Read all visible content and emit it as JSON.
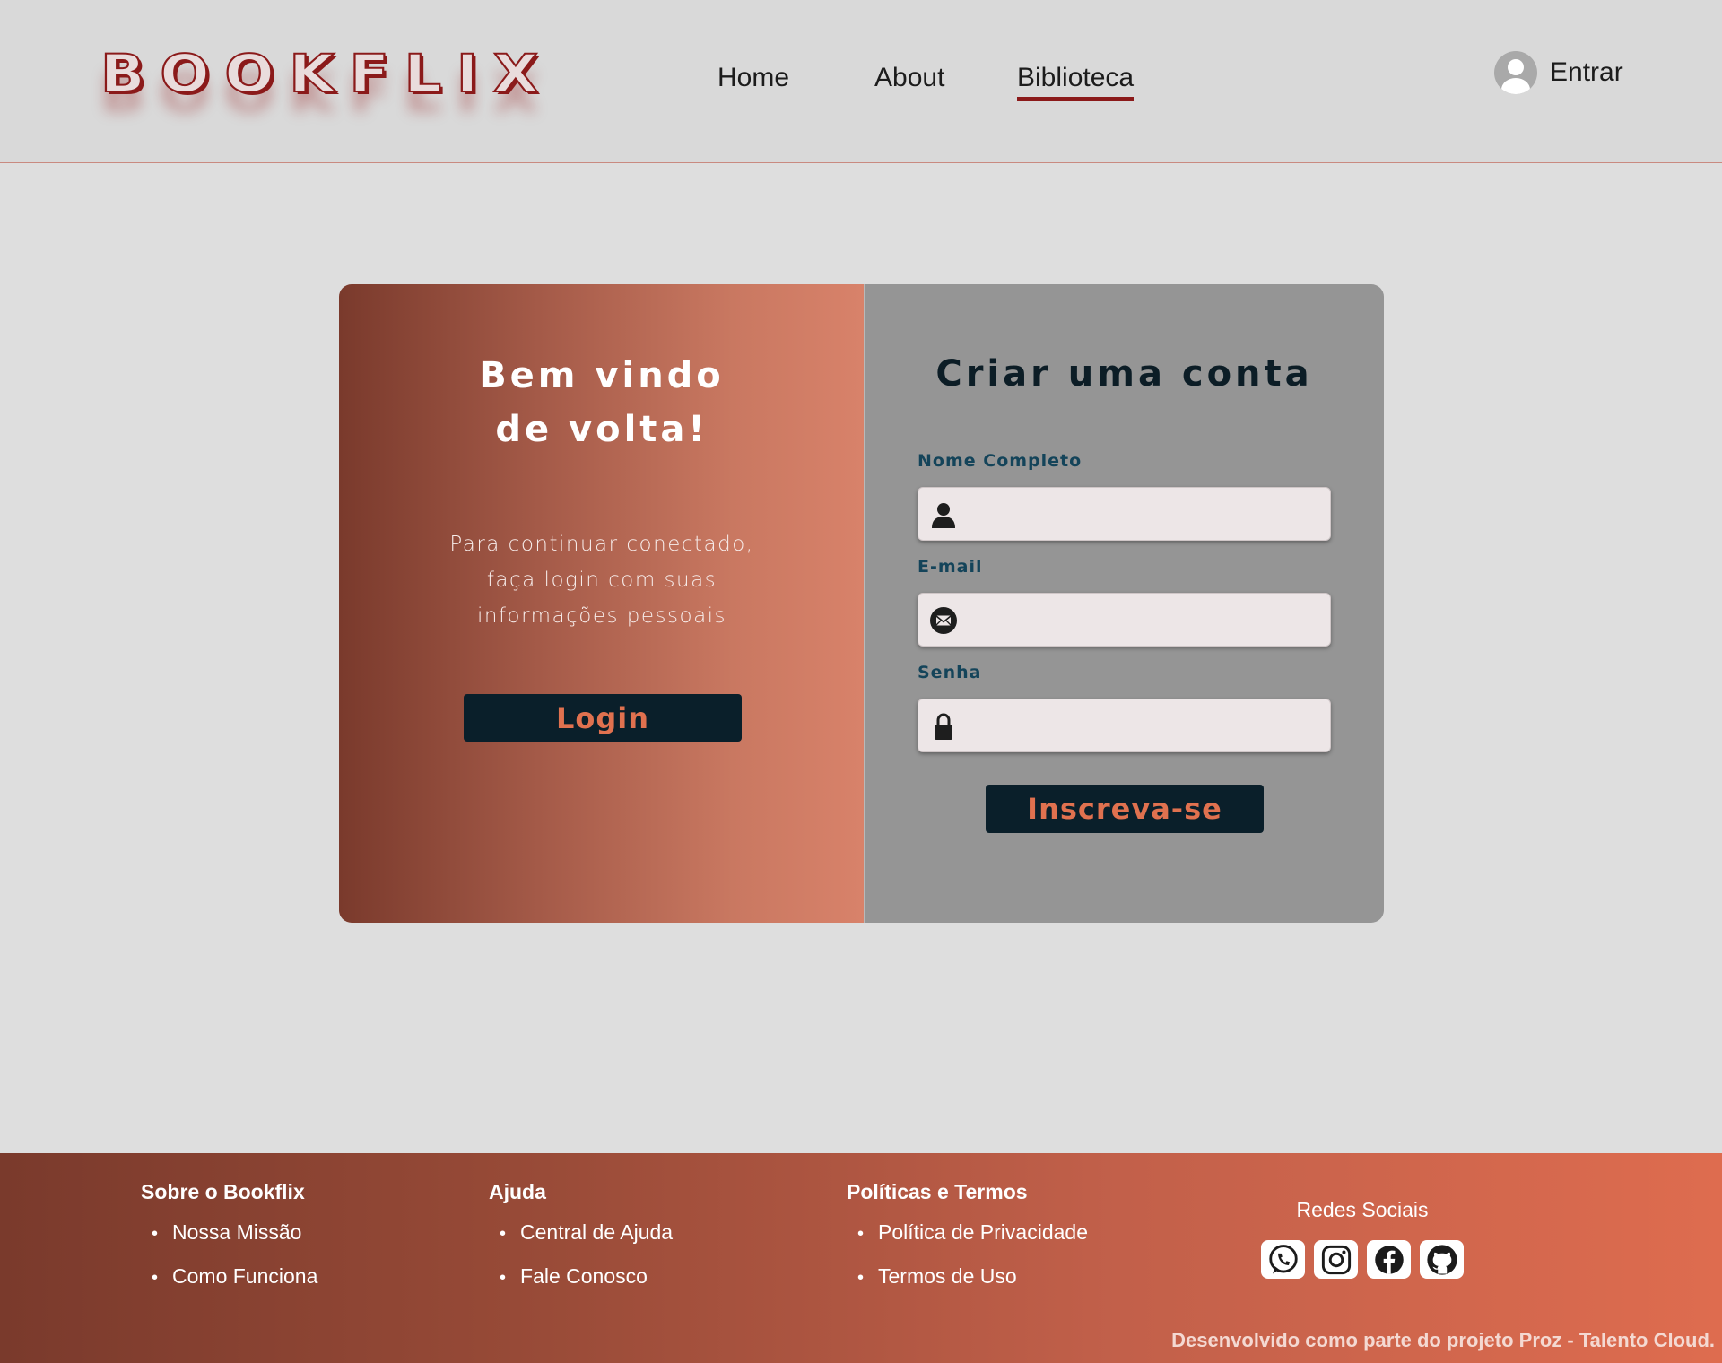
{
  "brand": {
    "logo_text": "BOOKFLIX"
  },
  "nav": {
    "items": [
      {
        "label": "Home"
      },
      {
        "label": "About"
      },
      {
        "label": "Biblioteca"
      }
    ],
    "active": "Biblioteca"
  },
  "user": {
    "label": "Entrar",
    "icon": "user-avatar-icon"
  },
  "welcome": {
    "title": "Bem vindo de volta!",
    "text": "Para continuar conectado, faça login com suas informações pessoais",
    "login_label": "Login"
  },
  "signup": {
    "title": "Criar uma conta",
    "fields": [
      {
        "label": "Nome Completo",
        "icon": "user-icon",
        "value": "",
        "placeholder": ""
      },
      {
        "label": "E-mail",
        "icon": "mail-icon",
        "value": "",
        "placeholder": ""
      },
      {
        "label": "Senha",
        "icon": "lock-icon",
        "value": "",
        "placeholder": ""
      }
    ],
    "submit_label": "Inscreva-se"
  },
  "footer": {
    "columns": [
      {
        "title": "Sobre o Bookflix",
        "links": [
          "Nossa Missão",
          "Como Funciona"
        ]
      },
      {
        "title": "Ajuda",
        "links": [
          "Central de Ajuda",
          "Fale Conosco"
        ]
      },
      {
        "title": "Políticas e Termos",
        "links": [
          "Política de Privacidade",
          "Termos de Uso"
        ]
      }
    ],
    "social": {
      "title": "Redes Sociais",
      "icons": [
        "whatsapp-icon",
        "instagram-icon",
        "facebook-icon",
        "github-icon"
      ]
    },
    "credit": "Desenvolvido como parte do projeto Proz - Talento Cloud."
  },
  "colors": {
    "accent": "#8b1a1a",
    "button_bg": "#0a1f2a",
    "button_text": "#e0714f",
    "gradient_start": "#7a3a2c",
    "gradient_end": "#de6c4f"
  }
}
